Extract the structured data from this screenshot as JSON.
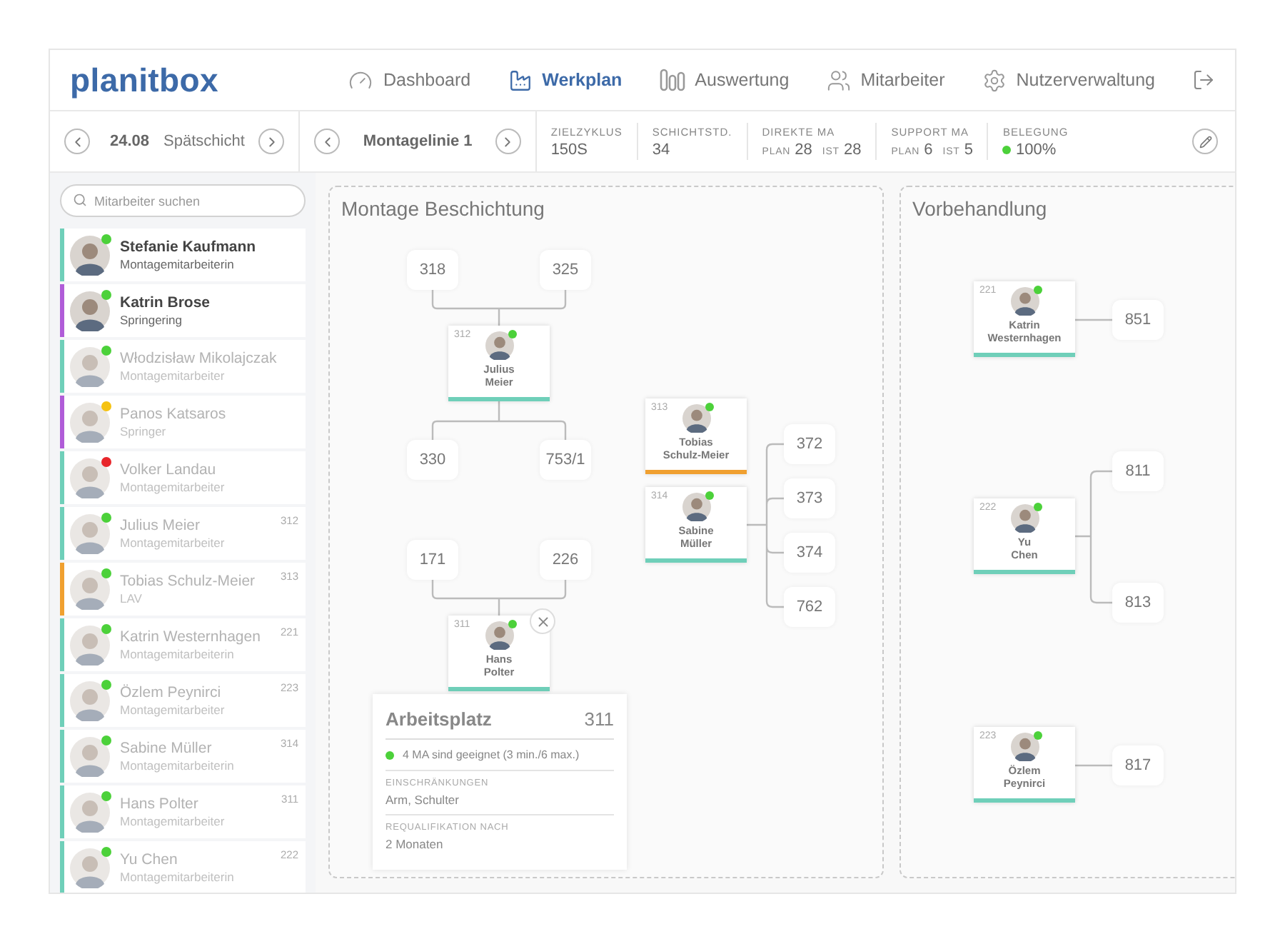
{
  "logo": "planitbox",
  "nav": [
    {
      "label": "Dashboard",
      "selected": false
    },
    {
      "label": "Werkplan",
      "selected": true
    },
    {
      "label": "Auswertung",
      "selected": false
    },
    {
      "label": "Mitarbeiter",
      "selected": false
    },
    {
      "label": "Nutzerverwaltung",
      "selected": false
    }
  ],
  "toolbar": {
    "shift": {
      "date": "24.08",
      "name": "Spätschicht"
    },
    "line": {
      "name": "Montagelinie 1"
    },
    "stats": [
      {
        "kind": "value",
        "label": "ZIELZYKLUS",
        "value": "150S"
      },
      {
        "kind": "value",
        "label": "SCHICHTSTD.",
        "value": "34"
      },
      {
        "kind": "plan_ist",
        "label": "DIREKTE MA",
        "plan_label": "PLAN",
        "plan": "28",
        "ist_label": "IST",
        "ist": "28"
      },
      {
        "kind": "plan_ist",
        "label": "SUPPORT MA",
        "plan_label": "PLAN",
        "plan": "6",
        "ist_label": "IST",
        "ist": "5"
      },
      {
        "kind": "status",
        "label": "BELEGUNG",
        "value": "100%",
        "color": "#4cd13a"
      }
    ]
  },
  "sidebar": {
    "search_placeholder": "Mitarbeiter suchen",
    "employees": [
      {
        "name": "Stefanie Kaufmann",
        "role": "Montagemitarbeiterin",
        "kind": "assembly",
        "color": "#4cd13a",
        "dimmed": false
      },
      {
        "name": "Katrin Brose",
        "role": "Springering",
        "kind": "floater",
        "color": "#4cd13a",
        "dimmed": false
      },
      {
        "name": "Włodzisław Mikolajczak",
        "role": "Montagemitarbeiter",
        "kind": "assembly",
        "color": "#4cd13a",
        "dimmed": true
      },
      {
        "name": "Panos Katsaros",
        "role": "Springer",
        "kind": "floater",
        "color": "#f5c211",
        "dimmed": true
      },
      {
        "name": "Volker Landau",
        "role": "Montagemitarbeiter",
        "kind": "assembly",
        "color": "#e8262b",
        "dimmed": true
      },
      {
        "name": "Julius Meier",
        "role": "Montagemitarbeiter",
        "number": "312",
        "kind": "assembly",
        "color": "#4cd13a",
        "dimmed": true
      },
      {
        "name": "Tobias Schulz-Meier",
        "role": "LAV",
        "number": "313",
        "kind": "lead",
        "color": "#4cd13a",
        "dimmed": true
      },
      {
        "name": "Katrin Westernhagen",
        "role": "Montagemitarbeiterin",
        "number": "221",
        "kind": "assembly",
        "color": "#4cd13a",
        "dimmed": true
      },
      {
        "name": "Özlem Peynirci",
        "role": "Montagemitarbeiter",
        "number": "223",
        "kind": "assembly",
        "color": "#4cd13a",
        "dimmed": true
      },
      {
        "name": "Sabine Müller",
        "role": "Montagemitarbeiterin",
        "number": "314",
        "kind": "assembly",
        "color": "#4cd13a",
        "dimmed": true
      },
      {
        "name": "Hans Polter",
        "role": "Montagemitarbeiter",
        "number": "311",
        "kind": "assembly",
        "color": "#4cd13a",
        "dimmed": true
      },
      {
        "name": "Yu Chen",
        "role": "Montagemitarbeiterin",
        "number": "222",
        "kind": "assembly",
        "color": "#4cd13a",
        "dimmed": true
      }
    ]
  },
  "panels": [
    {
      "title": "Montage Beschichtung",
      "groups": [
        {
          "kind": "vertical",
          "inputs": [
            "318",
            "325"
          ],
          "worker": {
            "number": "312",
            "name": "Julius Meier",
            "kind": "assembly",
            "color": "#4cd13a"
          },
          "outputs": [
            "330",
            "753/1"
          ]
        },
        {
          "kind": "horizontal",
          "workers": [
            {
              "number": "313",
              "name": "Tobias Schulz-Meier",
              "kind": "lead",
              "color": "#4cd13a"
            },
            {
              "number": "314",
              "name": "Sabine Müller",
              "kind": "assembly",
              "color": "#4cd13a"
            }
          ],
          "stations": [
            "372",
            "373",
            "374",
            "762"
          ]
        },
        {
          "kind": "vertical",
          "inputs": [
            "171",
            "226"
          ],
          "worker": {
            "number": "311",
            "name": "Hans Polter",
            "kind": "assembly",
            "color": "#4cd13a"
          },
          "popover": {
            "title": "Arbeitsplatz",
            "number": "311",
            "color": "#4cd13a",
            "message": "4 MA sind geeignet (3 min./6 max.)",
            "sections": [
              {
                "label": "EINSCHRÄNKUNGEN",
                "value": "Arm, Schulter"
              },
              {
                "label": "REQUALIFIKATION NACH",
                "value": "2 Monaten"
              }
            ]
          }
        }
      ]
    },
    {
      "title": "Vorbehandlung",
      "groups": [
        {
          "kind": "horizontal",
          "workers": [
            {
              "number": "221",
              "name": "Katrin Westernhagen",
              "kind": "assembly",
              "color": "#4cd13a"
            }
          ],
          "stations": [
            "851"
          ]
        },
        {
          "kind": "horizontal",
          "workers": [
            {
              "number": "222",
              "name": "Yu Chen",
              "kind": "assembly",
              "color": "#4cd13a"
            }
          ],
          "stations": [
            "811",
            "813"
          ]
        },
        {
          "kind": "horizontal",
          "workers": [
            {
              "number": "223",
              "name": "Özlem Peynirci",
              "kind": "assembly",
              "color": "#4cd13a"
            }
          ],
          "stations": [
            "817"
          ]
        }
      ]
    }
  ]
}
